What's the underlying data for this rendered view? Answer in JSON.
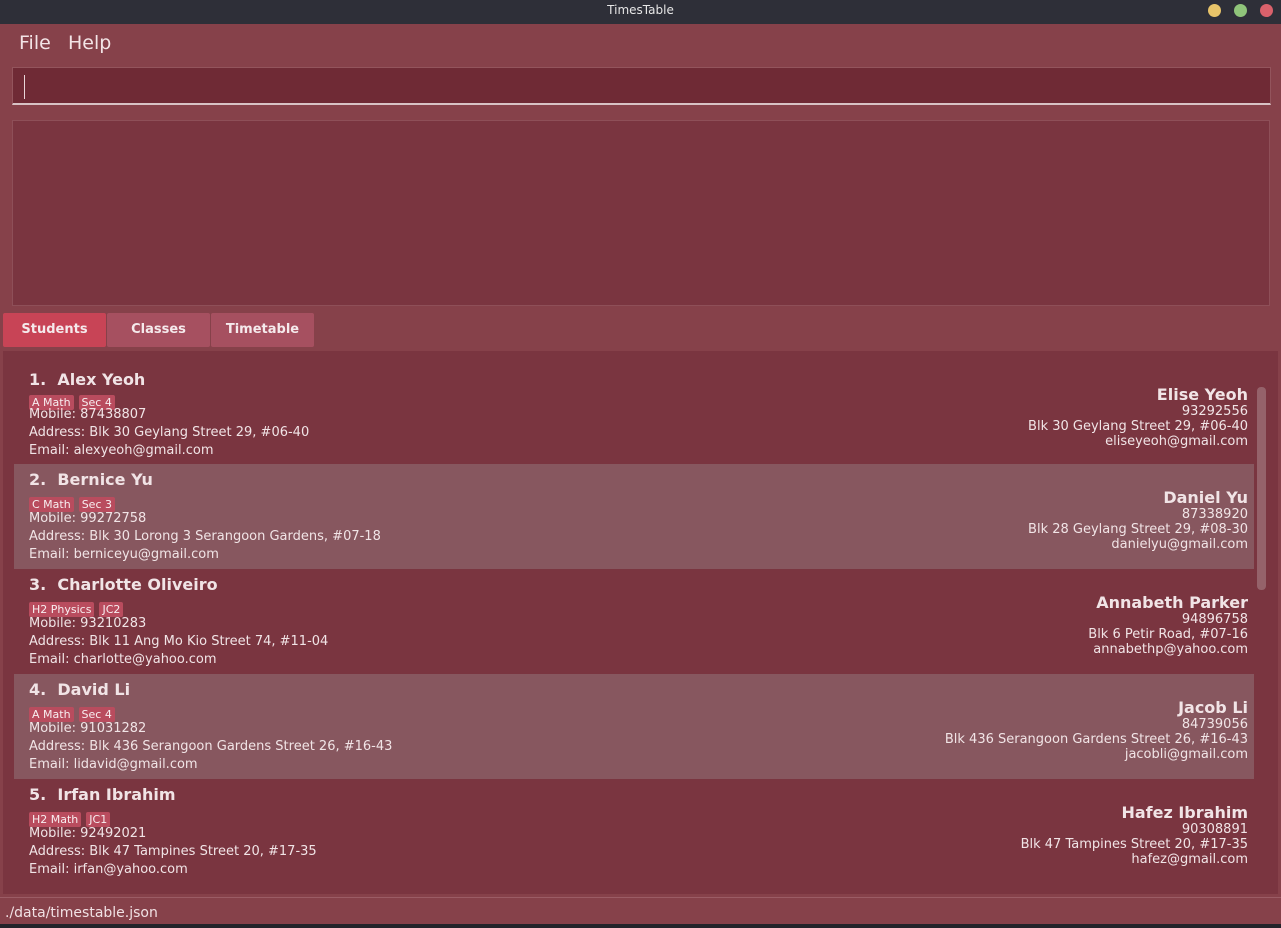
{
  "window": {
    "title": "TimesTable"
  },
  "menu": {
    "file": "File",
    "help": "Help"
  },
  "command": {
    "value": "",
    "placeholder": ""
  },
  "result": {
    "text": ""
  },
  "tabs": [
    {
      "label": "Students",
      "active": true
    },
    {
      "label": "Classes",
      "active": false
    },
    {
      "label": "Timetable",
      "active": false
    }
  ],
  "students": [
    {
      "index": "1.",
      "name": "Alex Yeoh",
      "tags": [
        "A Math",
        "Sec 4"
      ],
      "mobile": "Mobile: 87438807",
      "address": "Address: Blk 30 Geylang Street 29, #06-40",
      "email": "Email: alexyeoh@gmail.com",
      "parent": {
        "name": "Elise Yeoh",
        "phone": "93292556",
        "address": "Blk 30 Geylang Street 29, #06-40",
        "email": "eliseyeoh@gmail.com"
      }
    },
    {
      "index": "2.",
      "name": "Bernice Yu",
      "tags": [
        "C Math",
        "Sec 3"
      ],
      "mobile": "Mobile: 99272758",
      "address": "Address: Blk 30 Lorong 3 Serangoon Gardens, #07-18",
      "email": "Email: berniceyu@gmail.com",
      "parent": {
        "name": "Daniel Yu",
        "phone": "87338920",
        "address": "Blk 28 Geylang Street 29, #08-30",
        "email": "danielyu@gmail.com"
      }
    },
    {
      "index": "3.",
      "name": "Charlotte Oliveiro",
      "tags": [
        "H2 Physics",
        "JC2"
      ],
      "mobile": "Mobile: 93210283",
      "address": "Address: Blk 11 Ang Mo Kio Street 74, #11-04",
      "email": "Email: charlotte@yahoo.com",
      "parent": {
        "name": "Annabeth Parker",
        "phone": "94896758",
        "address": "Blk 6 Petir Road, #07-16",
        "email": "annabethp@yahoo.com"
      }
    },
    {
      "index": "4.",
      "name": "David Li",
      "tags": [
        "A Math",
        "Sec 4"
      ],
      "mobile": "Mobile: 91031282",
      "address": "Address: Blk 436 Serangoon Gardens Street 26, #16-43",
      "email": "Email: lidavid@gmail.com",
      "parent": {
        "name": "Jacob Li",
        "phone": "84739056",
        "address": "Blk 436 Serangoon Gardens Street 26, #16-43",
        "email": "jacobli@gmail.com"
      }
    },
    {
      "index": "5.",
      "name": "Irfan Ibrahim",
      "tags": [
        "H2 Math",
        "JC1"
      ],
      "mobile": "Mobile: 92492021",
      "address": "Address: Blk 47 Tampines Street 20, #17-35",
      "email": "Email: irfan@yahoo.com",
      "parent": {
        "name": "Hafez Ibrahim",
        "phone": "90308891",
        "address": "Blk 47 Tampines Street 20, #17-35",
        "email": "hafez@gmail.com"
      }
    }
  ],
  "status": {
    "path": "./data/timestable.json"
  },
  "colors": {
    "accent": "#c84456",
    "background": "#86414a",
    "card_alt": "#87575f",
    "tag": "#b94c5e"
  }
}
